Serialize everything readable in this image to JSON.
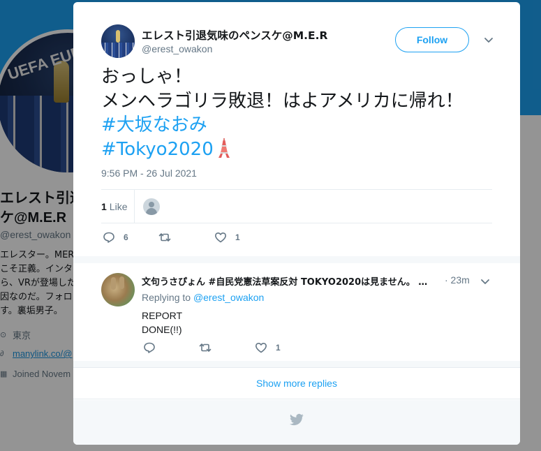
{
  "background": {
    "name_lines": [
      "エレスト引退",
      "ケ@M.E.R"
    ],
    "handle": "@erest_owakon",
    "bio_lines": [
      "エレスター。MER",
      "こそ正義。インタ",
      "ら、VRが登場した",
      "因なのだ。フォロ",
      "す。裏垢男子。"
    ],
    "location": "東京",
    "link": "manylink.co/@",
    "joined": "Joined Novem",
    "avatar_text": "UEFA EURO"
  },
  "tweet": {
    "display_name": "エレスト引退気味のペンスケ@M.E.R",
    "screen_name": "@erest_owakon",
    "follow_label": "Follow",
    "text_lines": [
      "おっしゃ！",
      "メンヘラゴリラ敗退！はよアメリカに帰れ！"
    ],
    "hashtags": [
      "#大坂なおみ",
      "#Tokyo2020"
    ],
    "tower_emoji_icon": "tokyo-tower-icon",
    "timestamp": "9:56 PM - 26 Jul 2021",
    "likes_count": "1",
    "likes_label": "Like",
    "actions": {
      "reply_count": "6",
      "retweet_count": "",
      "like_count": "1"
    }
  },
  "reply": {
    "name": "文句うさぴょん #自民党憲法草案反対 TOKYO2020は見ません。 …",
    "time": "· 23m",
    "replying_prefix": "Replying to",
    "replying_handle": "@erest_owakon",
    "text_lines": [
      "REPORT",
      "DONE(!!)"
    ],
    "actions": {
      "reply_count": "",
      "retweet_count": "",
      "like_count": "1"
    }
  },
  "show_more_label": "Show more replies",
  "colors": {
    "accent": "#1da1f2",
    "text": "#14171a",
    "muted": "#657786",
    "border": "#e6ecf0"
  }
}
